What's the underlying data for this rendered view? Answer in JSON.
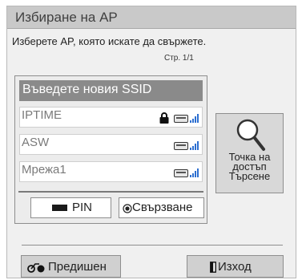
{
  "window": {
    "title": "Избиране на AP",
    "instruction": "Изберете AP, която искате да свържете.",
    "page_indicator": "Стр. 1/1"
  },
  "ap_list": {
    "new_ssid_label": "Въведете новия SSID",
    "items": [
      {
        "name": "IPTIME",
        "locked": true,
        "signal_icon": "wifi-signal-icon"
      },
      {
        "name": "ASW",
        "locked": false,
        "signal_icon": "wifi-signal-icon"
      },
      {
        "name": "Мрежа1",
        "locked": false,
        "signal_icon": "wifi-signal-icon"
      }
    ],
    "selected_index": -1
  },
  "buttons": {
    "pin_label": "PIN",
    "connect_label": "Свързване",
    "search_label_lines": [
      "Точка на",
      "достъп",
      "Търсене"
    ],
    "previous_label": "Предишен",
    "exit_label": "Изход"
  },
  "colors": {
    "title_bar": "#c9c9c9",
    "window_bg": "#f0f0f0",
    "highlight_row": "#8a8a8a",
    "signal_blue": "#2d6fd0"
  }
}
